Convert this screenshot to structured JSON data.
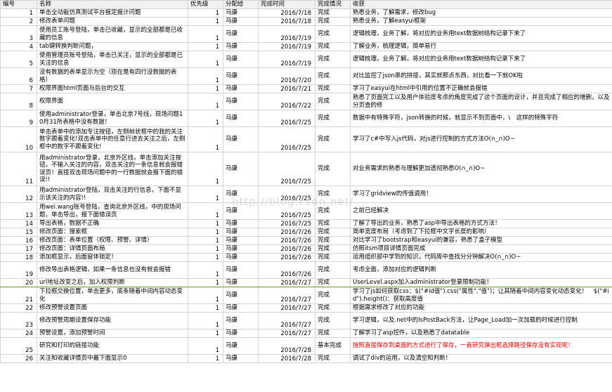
{
  "headers": [
    "编号",
    "名称",
    "优先级",
    "分配给",
    "完成时间",
    "完成情况",
    "收获"
  ],
  "watermark": "http://blog.csdn.net/",
  "colors": {
    "header_bg": "#f2f2f2",
    "grid": "#d4d4d4",
    "red_text": "#e00000",
    "selected_border": "#6a9a1f"
  },
  "rows": [
    {
      "id": "1",
      "name": "单击全动能仿真测试平台报定报计问题",
      "priority": "1",
      "assignee": "马康",
      "date": "2016/7/18",
      "status": "完成",
      "gain": "熟悉业务，了解需求，修改bug"
    },
    {
      "id": "2",
      "name": "修改表单问题",
      "priority": "1",
      "assignee": "马康",
      "date": "2016/7/18",
      "status": "完成",
      "gain": "熟悉业务，了解easyui框架"
    },
    {
      "id": "3",
      "name": "使用员工账号登陆，单击已收藏，显示的全部都是已收藏的信息",
      "priority": "1",
      "assignee": "马康",
      "date": "2016/7/19",
      "status": "完成",
      "gain": "逻辑梳理，业务了解，将对应的业务用text数据树结构记录下来了"
    },
    {
      "id": "4",
      "name": "tab键转换判断问题，",
      "priority": "1",
      "assignee": "马康",
      "date": "2016/7/19",
      "status": "完成",
      "gain": "了解业务，梳理逻辑，简单易行"
    },
    {
      "id": "5",
      "name": "使用管理员账号登陆，单击已关注，显示的全部都是已关注的信息",
      "priority": "1",
      "assignee": "马康",
      "date": "2016/7/19",
      "status": "完成",
      "gain": "逻辑梳理，业务了解，将对应的业务用text数据树结构记录下来了"
    },
    {
      "id": "6",
      "name": "没有数据的表单显示为空（现在是有四行没数据的表格）",
      "priority": "1",
      "assignee": "马康",
      "date": "2016/7/20",
      "status": "完成",
      "gain": "对比监控了json串的拼接，其实就那点东西，对比看一下就OK啦"
    },
    {
      "id": "7",
      "name": "权限界面html页面与后台的交互",
      "priority": "1",
      "assignee": "马康",
      "date": "2016/7/21",
      "status": "完成",
      "gain": "学习了easyui在html中引用的位置不正确就会报错"
    },
    {
      "id": "8",
      "name": "权限界面",
      "priority": "1",
      "assignee": "马康",
      "date": "2016/7/22",
      "status": "完成",
      "gain": "熟悉了页面完工以及用户体验度考虑的角度完成了这个页面的设计，并且完成了相应的增删，以及分页查的修"
    },
    {
      "id": "9",
      "name": "使用administrator登录，单击北京7号线，现场问题10月31所表格中没有数据！",
      "priority": "1",
      "assignee": "马康",
      "date": "2016/7/25",
      "status": "完成",
      "gain": "数据中有特殊字符，json转换的时候，就显示不到页面中，\\　这样的特殊字符"
    },
    {
      "id": "10",
      "name": "单击表单中的添加专注按钮，左侧树状框中的我的关注数字跟着变化!双击表单中的任意行进去关注之后，左侧框中的数字不跟着变化!",
      "priority": "1",
      "assignee": "马康",
      "date": "2016/7/25",
      "status": "完成",
      "gain": "学习了c#中写入js代码，对js进行控制的方式方法O(∩_∩)O~"
    },
    {
      "id": "11",
      "name": "用administrator登录，北京外区线，单击添加关注按钮，不输入关注的内容，双击关注的一条信息就会报错误页！直接双击现场问题中的一行数据就会报下面的错误!!",
      "priority": "1",
      "assignee": "马康",
      "date": "2016/7/25",
      "status": "完成",
      "gain": "对业务需求的熟悉与理解更加透彻熟悉O(∩_∩)O~"
    },
    {
      "id": "12",
      "name": "用administrator登陆，双击关注的行信息，下面不显示该关注的内容!!",
      "priority": "1",
      "assignee": "马康",
      "date": "2016/7/25",
      "status": "完成",
      "gain": "学习了gridview的传值调用！"
    },
    {
      "id": "13",
      "name": "用wei.wang账号登陆，查询北京外区线，中的现场问题，单击导出，报下面错误页",
      "priority": "1",
      "assignee": "马康",
      "date": "2016/7/25",
      "status": "完成",
      "gain": "之前已经解决"
    },
    {
      "id": "14",
      "name": "导出表格，数据不正确",
      "priority": "1",
      "assignee": "马康",
      "date": "2016/7/25",
      "status": "完成",
      "gain": "了解了导出的业务，熟悉了asp中导出表格的方式方法！"
    },
    {
      "id": "15",
      "name": "修改页面：搜索框",
      "priority": "1",
      "assignee": "马康",
      "date": "2016/7/26",
      "status": "完成",
      "gain": "简单宽度布局（考虑到了下拉框中文字长度的影响）"
    },
    {
      "id": "16",
      "name": "修改页面：表单位置（权限、预警、详情）",
      "priority": "1",
      "assignee": "马康",
      "date": "2016/7/26",
      "status": "完成",
      "gain": "对比学习了bootstrap和easyui的兼容，熟悉了盒子模型"
    },
    {
      "id": "17",
      "name": "修改页面：详情页面布局",
      "priority": "1",
      "assignee": "马康",
      "date": "2016/7/26",
      "status": "完成",
      "gain": "仿照itsm项目详情页面完成"
    },
    {
      "id": "18",
      "name": "添加框显示，后面窗体锁定！",
      "priority": "1",
      "assignee": "马康",
      "date": "2016/7/26",
      "status": "完成",
      "gain": "运用组织部中学到的知识，代码库中查找分分钟解决O(∩_∩)O~"
    },
    {
      "id": "19",
      "name": "修改导出表格逻辑，如果一条信息也没有就会报错",
      "priority": "1",
      "assignee": "马康",
      "date": "2016/7/26",
      "status": "完成",
      "gain": "考虑全面，添加对应的逻辑判断"
    },
    {
      "id": "20",
      "name": "url地址改变之后，加入权限判断",
      "priority": "1",
      "assignee": "马康",
      "date": "2016/7/27",
      "status": "完成",
      "gain": "UserLevel.aspx加入administrator登录限制功能！"
    },
    {
      "id": "21",
      "name": "下拉框交换位置，单击更多，底条随着中间内容动态变化",
      "priority": "1",
      "assignee": "马康",
      "date": "2016/7/27",
      "status": "完成",
      "gain": "学习了js如何获取css：$(\"#id值\").css(\"属性\",\"值\")；让其随着中间内容变化动态变化！　$(\"#id\").height()：获取高度值"
    },
    {
      "id": "22",
      "name": "修改预警设置页面",
      "priority": "1",
      "assignee": "马康",
      "date": "2016/7/27",
      "status": "完成",
      "gain": "根据需求修改了对应的功能"
    },
    {
      "id": "23",
      "name": "修改预警周期设置保存功能",
      "priority": "1",
      "assignee": "马康",
      "date": "2016/7/27",
      "status": "完成",
      "gain": "学习逻辑，以及.net中的IsPostBack方法，让Page_Load加一次加载的时候进行控制"
    },
    {
      "id": "24",
      "name": "预警设置，添加预警时间",
      "priority": "1",
      "assignee": "马康",
      "date": "2016/7/27",
      "status": "完成",
      "gain": "了解学习了asp控件，以及熟悉了datatable"
    },
    {
      "id": "25",
      "name": "研究和打印的链接功能",
      "priority": "1",
      "assignee": "马康",
      "date": "2016/7/28",
      "status": "基本完成",
      "gain": "按照直接保存到桌面的方式进行了保存，一直研究弹出框选择路径保存没有实现呢！"
    },
    {
      "id": "26",
      "name": "关注和收藏详情页中最下面显示0",
      "priority": "1",
      "assignee": "马康",
      "date": "2016/7/28",
      "status": "完成",
      "gain": "调试了div的运用，以及清空和判断！"
    }
  ]
}
